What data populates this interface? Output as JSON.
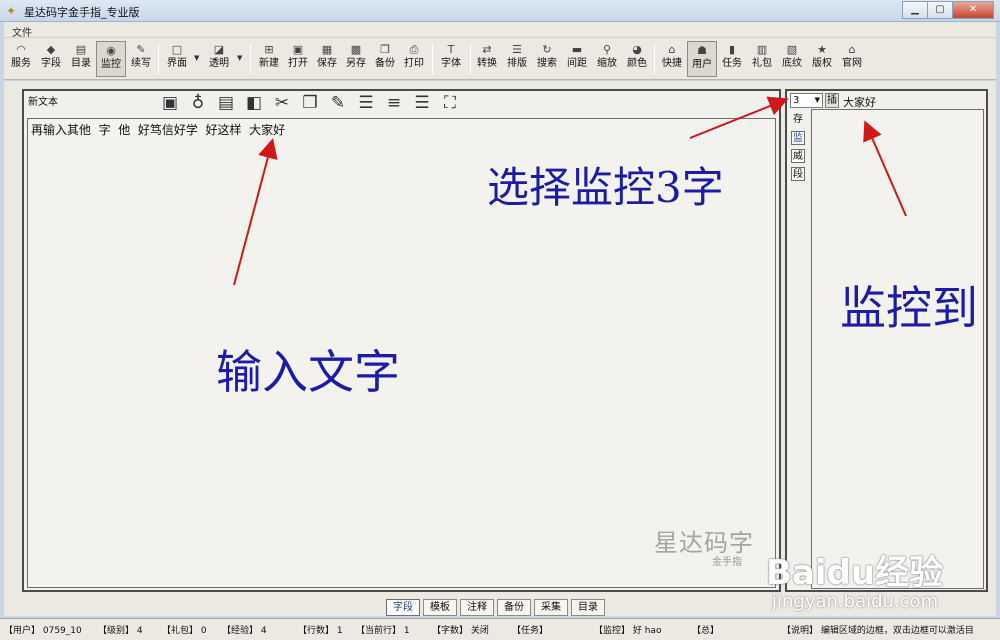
{
  "window": {
    "title": "星达码字金手指_专业版",
    "controls": [
      "minimize",
      "maximize",
      "close"
    ]
  },
  "menu": {
    "file": "文件"
  },
  "toolbar": {
    "buttons": [
      {
        "label": "服务",
        "icon": "rss-icon"
      },
      {
        "label": "字段",
        "icon": "diamond-icon"
      },
      {
        "label": "目录",
        "icon": "list-icon"
      },
      {
        "label": "监控",
        "icon": "monitor-icon",
        "active": true
      },
      {
        "label": "续写",
        "icon": "pen-icon"
      },
      {
        "label": "界面",
        "icon": "window-icon",
        "dropdown": true
      },
      {
        "label": "透明",
        "icon": "transparency-icon",
        "dropdown": true
      },
      {
        "label": "新建",
        "icon": "new-icon"
      },
      {
        "label": "打开",
        "icon": "open-icon"
      },
      {
        "label": "保存",
        "icon": "save-icon"
      },
      {
        "label": "另存",
        "icon": "save-as-icon"
      },
      {
        "label": "备份",
        "icon": "backup-icon"
      },
      {
        "label": "打印",
        "icon": "print-icon"
      },
      {
        "label": "字体",
        "icon": "font-icon"
      },
      {
        "label": "转换",
        "icon": "convert-icon"
      },
      {
        "label": "排版",
        "icon": "layout-icon"
      },
      {
        "label": "搜索",
        "icon": "refresh-search-icon"
      },
      {
        "label": "间距",
        "icon": "spacing-icon"
      },
      {
        "label": "缩放",
        "icon": "zoom-icon"
      },
      {
        "label": "颜色",
        "icon": "color-icon"
      },
      {
        "label": "快捷",
        "icon": "shortcut-icon"
      },
      {
        "label": "用户",
        "icon": "user-icon",
        "active": true
      },
      {
        "label": "任务",
        "icon": "task-icon"
      },
      {
        "label": "礼包",
        "icon": "gift-icon"
      },
      {
        "label": "底纹",
        "icon": "texture-icon"
      },
      {
        "label": "版权",
        "icon": "star-icon"
      },
      {
        "label": "官网",
        "icon": "website-icon"
      }
    ]
  },
  "editor": {
    "doc_name": "新文本",
    "content": "再输入其他  字  他  好笃信好学  好这样  大家好",
    "toolbar_icons": [
      "save-icon",
      "idea-bulb-icon",
      "document-icon",
      "back-arrow-icon",
      "cut-icon",
      "copy-icon",
      "edit-icon",
      "align-left-icon",
      "align-center-icon",
      "align-right-icon",
      "fullscreen-icon"
    ]
  },
  "monitor": {
    "select_value": "3",
    "insert_label": "插",
    "watched_text": "大家好",
    "side_buttons": [
      "存",
      "监",
      "威",
      "段"
    ]
  },
  "watermark": {
    "brand": "星达码字",
    "sub": "金手指"
  },
  "annotations": {
    "input_text": "输入文字",
    "select_monitor": "选择监控3字",
    "monitored": "监控到"
  },
  "tabs": [
    "字段",
    "模板",
    "注释",
    "备份",
    "采集",
    "目录"
  ],
  "status": {
    "user": "【用户】 0759_10",
    "level": "【级别】 4",
    "gift": "【礼包】 0",
    "exp": "【经验】 4",
    "lines": "【行数】 1",
    "current_line": "【当前行】 1",
    "word_count": "【字数】 关闭",
    "task": "【任务】",
    "monitor": "【监控】 好 hao",
    "total": "【总】",
    "help": "【说明】 编辑区域的边框，双击边框可以激活目"
  },
  "baidu": {
    "brand": "Baidu经验",
    "url": "jingyan.baidu.com"
  },
  "colors": {
    "annotation": "#1c1ca8",
    "arrow": "#d01818"
  }
}
